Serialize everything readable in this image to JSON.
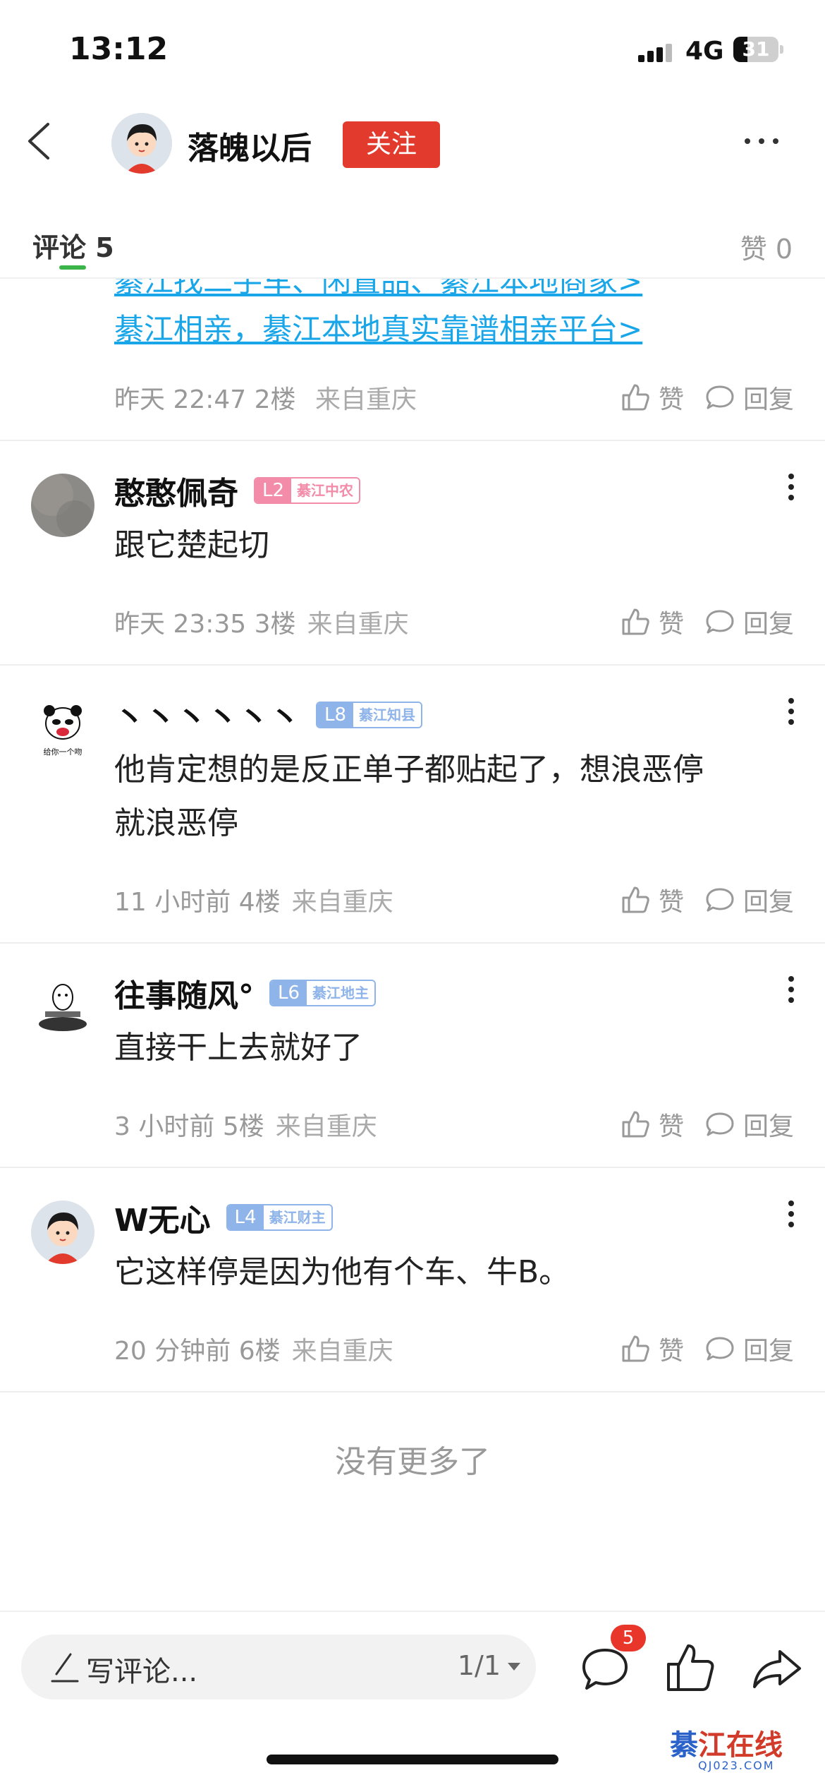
{
  "status_bar": {
    "time": "13:12",
    "network": "4G",
    "battery": "31",
    "battery_level": 0.31
  },
  "header": {
    "author": "落魄以后",
    "follow_label": "关注"
  },
  "tabs": {
    "comments_label": "评论",
    "comments_count": "5",
    "likes_label": "赞",
    "likes_count": "0"
  },
  "partial_comment": {
    "link_top": "綦江找二手车、闲置品、綦江本地商家>",
    "link": "綦江相亲，綦江本地真实靠谱相亲平台>",
    "time": "昨天 22:47",
    "floor": "2楼",
    "from": "来自重庆"
  },
  "actions": {
    "like": "赞",
    "reply": "回复"
  },
  "comments": [
    {
      "name": "憨憨佩奇",
      "level": "L2",
      "title": "綦江中农",
      "level_color": "#f28ca8",
      "lines": [
        "跟它楚起切"
      ],
      "time": "昨天 23:35",
      "floor": "3楼",
      "from": "来自重庆"
    },
    {
      "name": "丶丶丶丶丶丶",
      "level": "L8",
      "title": "綦江知县",
      "level_color": "#8fb4ea",
      "lines": [
        "他肯定想的是反正单子都贴起了，想浪恶停",
        "就浪恶停"
      ],
      "time": "11 小时前",
      "floor": "4楼",
      "from": "来自重庆",
      "avatar_caption": "给你一个吻"
    },
    {
      "name": "往事随风°",
      "level": "L6",
      "title": "綦江地主",
      "level_color": "#8fb4ea",
      "lines": [
        "直接干上去就好了"
      ],
      "time": "3 小时前",
      "floor": "5楼",
      "from": "来自重庆"
    },
    {
      "name": "W无心",
      "level": "L4",
      "title": "綦江财主",
      "level_color": "#8fb4ea",
      "lines": [
        "它这样停是因为他有个车、牛B。"
      ],
      "time": "20 分钟前",
      "floor": "6楼",
      "from": "来自重庆"
    }
  ],
  "footer_text": "没有更多了",
  "bottom_bar": {
    "placeholder": "写评论...",
    "page": "1/1",
    "comment_count": "5"
  },
  "watermark": {
    "text_1": "綦",
    "text_2": "江在线",
    "url": "QJ023.COM"
  }
}
